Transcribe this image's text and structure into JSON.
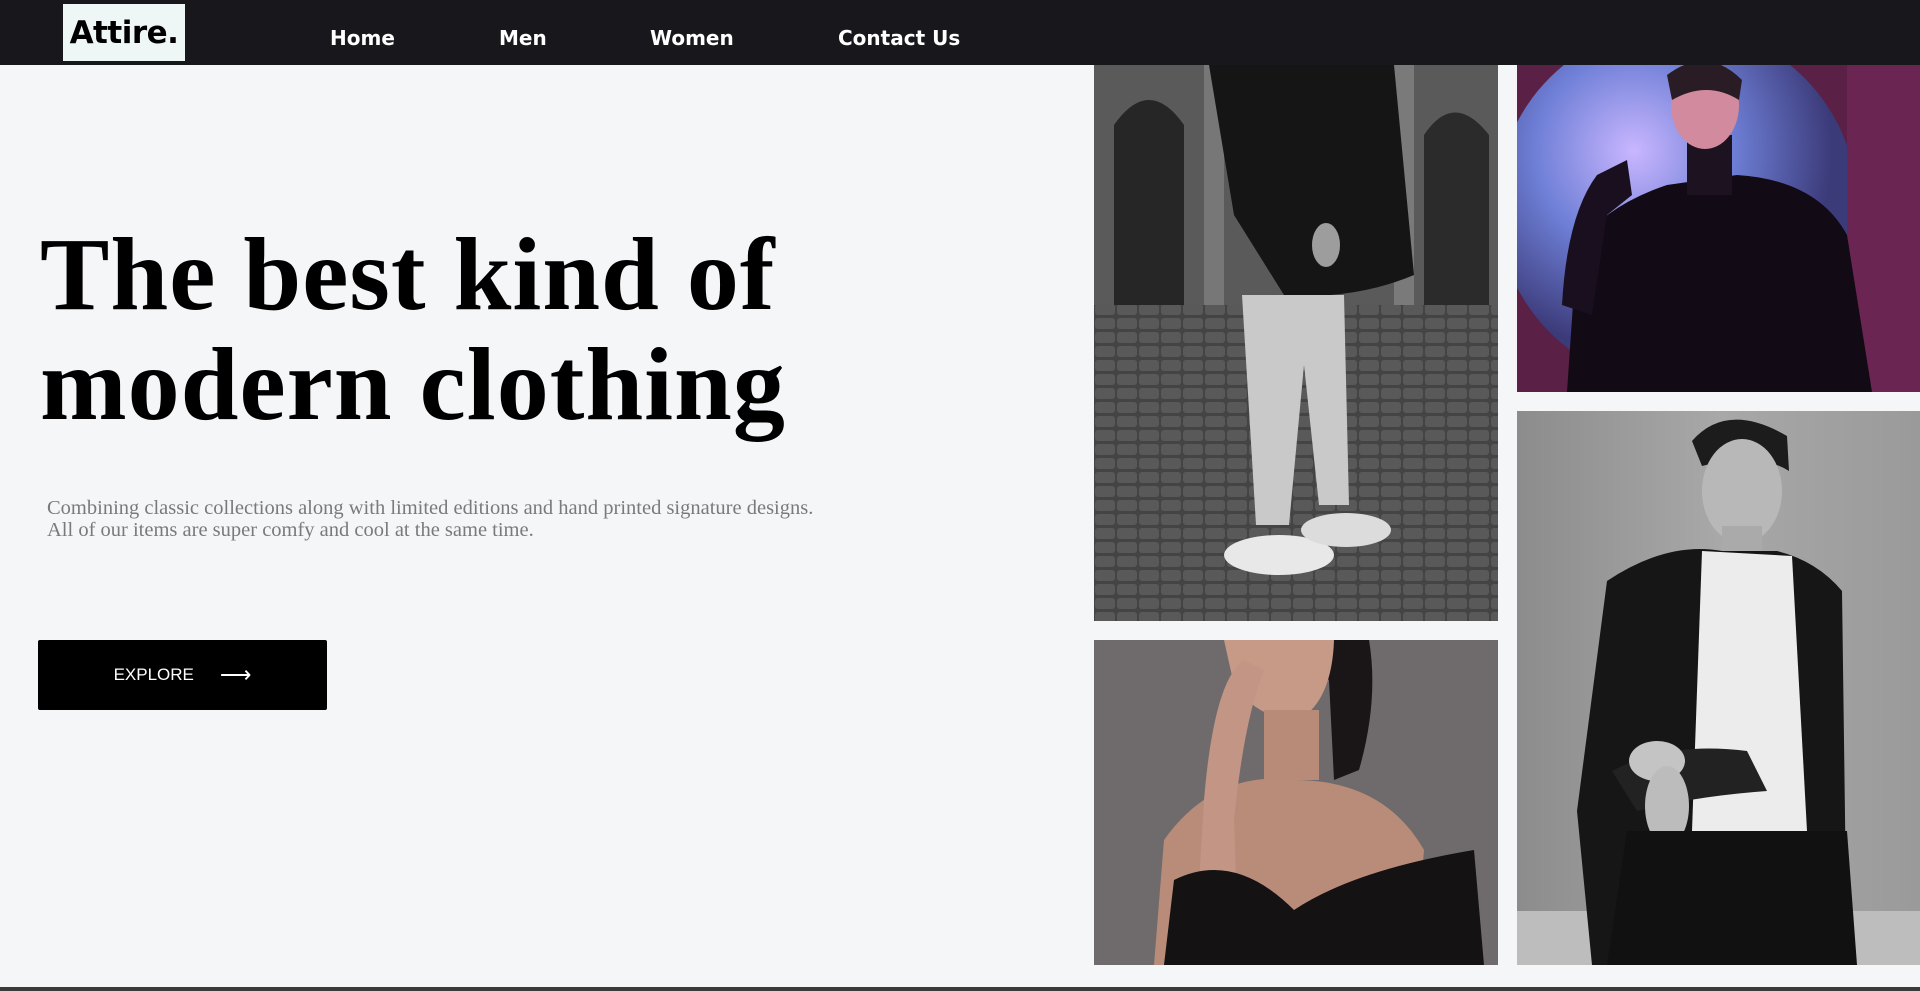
{
  "header": {
    "logo": "Attire.",
    "nav": [
      {
        "label": "Home"
      },
      {
        "label": "Men"
      },
      {
        "label": "Women"
      },
      {
        "label": "Contact Us"
      }
    ]
  },
  "hero": {
    "title_line1": "The best kind of",
    "title_line2": "modern clothing",
    "subtitle": "Combining classic collections along with limited editions and hand printed signature designs. All of our items are super comfy and cool at the same time.",
    "cta_label": "EXPLORE",
    "cta_icon": "right-arrow-icon",
    "cta_arrow": "⟶"
  },
  "gallery": [
    {
      "name": "man-walking-street-photo"
    },
    {
      "name": "woman-moon-backdrop-photo"
    },
    {
      "name": "woman-portrait-photo"
    },
    {
      "name": "man-black-suit-photo"
    }
  ],
  "colors": {
    "navbar": "#18181c",
    "background": "#f5f6f8",
    "logo_bg": "#eef6f6",
    "button": "#000000",
    "subtitle_text": "#7a7a7a"
  }
}
